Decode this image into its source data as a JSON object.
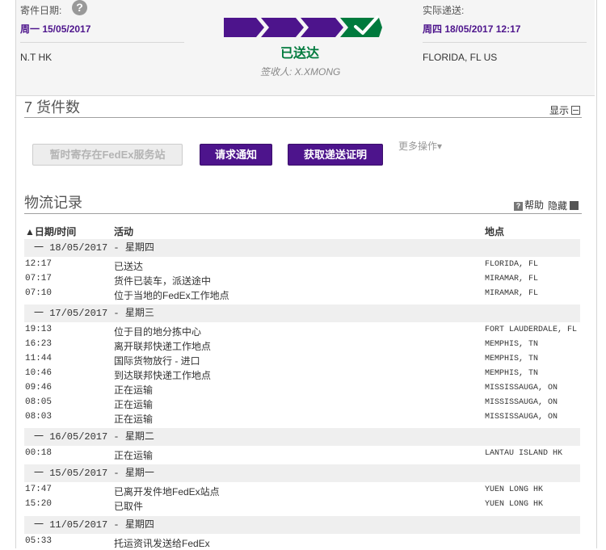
{
  "summary": {
    "ship_date_label": "寄件日期:",
    "ship_date_value": "周一 15/05/2017",
    "origin": "N.T HK",
    "status": "已送达",
    "signed_by": "签收人: X.XMONG",
    "actual_delivery_label": "实际递送:",
    "actual_delivery_value": "周四 18/05/2017 12:17",
    "destination": "FLORIDA, FL US"
  },
  "pieces": {
    "title": "7 货件数",
    "show_label": "显示"
  },
  "actions": {
    "hold_button": "暂时寄存在FedEx服务站",
    "notify_button": "请求通知",
    "proof_button": "获取递送证明",
    "more_label": "更多操作▾"
  },
  "travel": {
    "title": "物流记录",
    "help_label": "帮助",
    "hide_label": "隐藏",
    "col_date": "▲日期/时间",
    "col_activity": "活动",
    "col_location": "地点",
    "days": [
      {
        "label": "一  18/05/2017 - 星期四",
        "events": [
          {
            "time": "12:17",
            "activity": "已送达",
            "location": "FLORIDA, FL"
          },
          {
            "time": "07:17",
            "activity": "货件已装车，派送途中",
            "location": "MIRAMAR, FL"
          },
          {
            "time": "07:10",
            "activity": "位于当地的FedEx工作地点",
            "location": "MIRAMAR, FL"
          }
        ]
      },
      {
        "label": "一  17/05/2017 - 星期三",
        "events": [
          {
            "time": "19:13",
            "activity": "位于目的地分拣中心",
            "location": "FORT LAUDERDALE, FL"
          },
          {
            "time": "16:23",
            "activity": "离开联邦快递工作地点",
            "location": "MEMPHIS, TN"
          },
          {
            "time": "11:44",
            "activity": "国际货物放行 - 进口",
            "location": "MEMPHIS, TN"
          },
          {
            "time": "10:46",
            "activity": "到达联邦快递工作地点",
            "location": "MEMPHIS, TN"
          },
          {
            "time": "09:46",
            "activity": "正在运输",
            "location": "MISSISSAUGA, ON"
          },
          {
            "time": "08:05",
            "activity": "正在运输",
            "location": "MISSISSAUGA, ON"
          },
          {
            "time": "08:03",
            "activity": "正在运输",
            "location": "MISSISSAUGA, ON"
          }
        ]
      },
      {
        "label": "一  16/05/2017 - 星期二",
        "events": [
          {
            "time": "00:18",
            "activity": "正在运输",
            "location": "LANTAU ISLAND HK"
          }
        ]
      },
      {
        "label": "一  15/05/2017 - 星期一",
        "events": [
          {
            "time": "17:47",
            "activity": "已离开发件地FedEx站点",
            "location": "YUEN LONG HK"
          },
          {
            "time": "15:20",
            "activity": "已取件",
            "location": "YUEN LONG HK"
          }
        ]
      },
      {
        "label": "一  11/05/2017 - 星期四",
        "events": [
          {
            "time": "05:33",
            "activity": "托运资讯发送给FedEx",
            "location": ""
          }
        ]
      }
    ]
  },
  "colors": {
    "brand_purple": "#4d148c",
    "delivered_green": "#007a3d"
  }
}
